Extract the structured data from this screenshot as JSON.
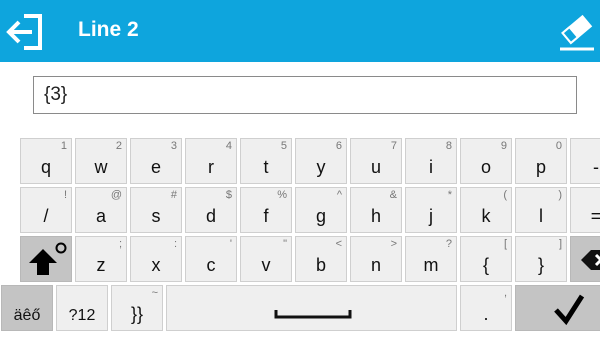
{
  "header": {
    "title": "Line 2"
  },
  "input": {
    "value": "{3}"
  },
  "keyboard": {
    "row1": [
      {
        "main": "q",
        "sup": "1"
      },
      {
        "main": "w",
        "sup": "2"
      },
      {
        "main": "e",
        "sup": "3"
      },
      {
        "main": "r",
        "sup": "4"
      },
      {
        "main": "t",
        "sup": "5"
      },
      {
        "main": "y",
        "sup": "6"
      },
      {
        "main": "u",
        "sup": "7"
      },
      {
        "main": "i",
        "sup": "8"
      },
      {
        "main": "o",
        "sup": "9"
      },
      {
        "main": "p",
        "sup": "0"
      },
      {
        "main": "-",
        "sup": "_"
      }
    ],
    "row2": [
      {
        "main": "/",
        "sup": "!"
      },
      {
        "main": "a",
        "sup": "@"
      },
      {
        "main": "s",
        "sup": "#"
      },
      {
        "main": "d",
        "sup": "$"
      },
      {
        "main": "f",
        "sup": "%"
      },
      {
        "main": "g",
        "sup": "^"
      },
      {
        "main": "h",
        "sup": "&"
      },
      {
        "main": "j",
        "sup": "*"
      },
      {
        "main": "k",
        "sup": "("
      },
      {
        "main": "l",
        "sup": ")"
      },
      {
        "main": "=",
        "sup": "+"
      }
    ],
    "row3": [
      {
        "main": "z",
        "sup": ";"
      },
      {
        "main": "x",
        "sup": ":"
      },
      {
        "main": "c",
        "sup": "'"
      },
      {
        "main": "v",
        "sup": "\""
      },
      {
        "main": "b",
        "sup": "<"
      },
      {
        "main": "n",
        "sup": ">"
      },
      {
        "main": "m",
        "sup": "?"
      },
      {
        "main": "{",
        "sup": "["
      },
      {
        "main": "}",
        "sup": "]"
      }
    ],
    "row4": {
      "accents": "äêő",
      "numbers": "?12",
      "brackets": "}}",
      "brackets_sup": "~",
      "dot": ".",
      "dot_sup": ","
    }
  },
  "colors": {
    "header": "#0ea5dd",
    "key": "#efefef",
    "key_dark": "#c4c4c4"
  },
  "icons": {
    "back": "exit-arrow-icon",
    "clear": "eraser-icon",
    "shift": "shift-arrow-icon",
    "backspace": "backspace-icon",
    "space": "space-bar-icon",
    "ok": "check-mark-icon"
  }
}
